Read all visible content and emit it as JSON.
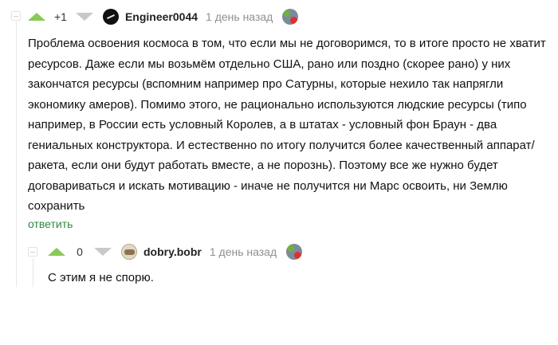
{
  "comments": [
    {
      "rating": "+1",
      "username": "Engineer0044",
      "timestamp": "1 день назад",
      "body_lines": [
        "Проблема освоения космоса в том, что если мы не договоримся, то в итоге просто не хватит",
        "ресурсов. Даже если мы возьмём отдельно США, рано или поздно (скорее рано) у них",
        "закончатся ресурсы (вспомним например про Сатурны, которые нехило так напрягли",
        "экономику амеров). Помимо этого, не рационально используются людские ресурсы (типо",
        "например, в России есть условный Королев, а в штатах - условный фон Браун - два",
        "гениальных конструктора. И естественно по итогу получится более качественный аппарат/",
        "ракета, если они будут работать вместе, а не порознь). Поэтому все же нужно будет",
        "договариваться и искать мотивацию - иначе не получится ни Марс освоить, ни Землю",
        "сохранить"
      ],
      "reply_label": "ответить"
    },
    {
      "rating": "0",
      "username": "dobry.bobr",
      "timestamp": "1 день назад",
      "body_lines": [
        "С этим я не спорю."
      ]
    }
  ],
  "colors": {
    "upvote": "#8ac858",
    "downvote": "#c9c9c9",
    "reply_link": "#2f8a3d"
  }
}
